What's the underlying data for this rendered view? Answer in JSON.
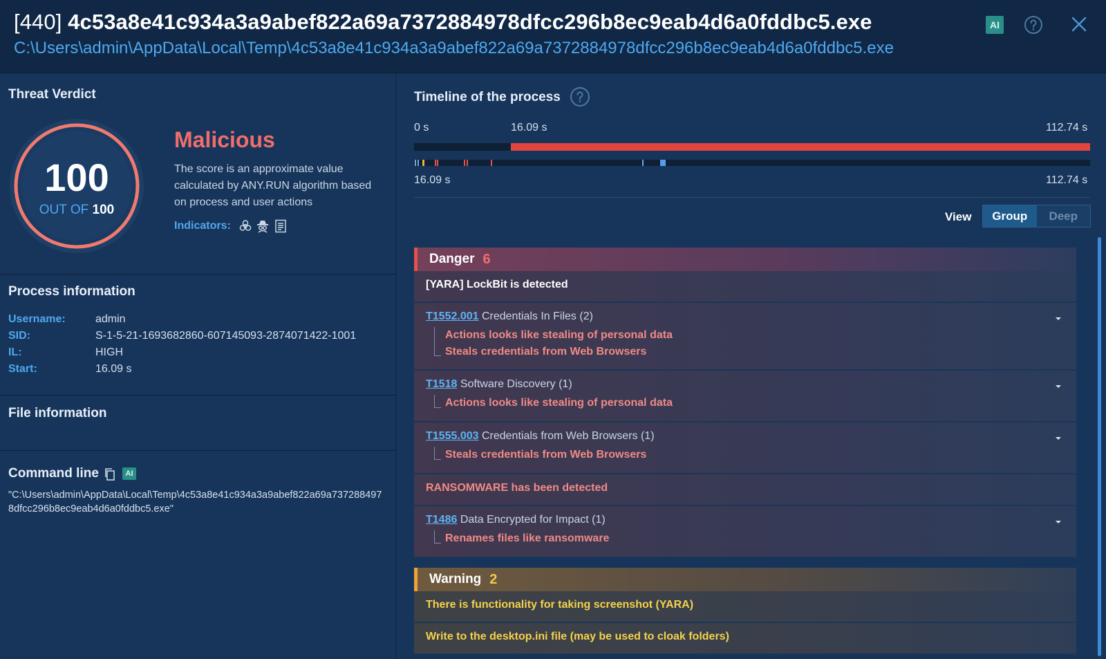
{
  "header": {
    "pid": "[440]",
    "name": "4c53a8e41c934a3a9abef822a69a7372884978dfcc296b8ec9eab4d6a0fddbc5.exe",
    "path": "C:\\Users\\admin\\AppData\\Local\\Temp\\4c53a8e41c934a3a9abef822a69a7372884978dfcc296b8ec9eab4d6a0fddbc5.exe",
    "ai_badge": "AI",
    "icons": [
      "help-icon",
      "close-icon"
    ]
  },
  "threat_verdict": {
    "title": "Threat Verdict",
    "score": "100",
    "out_of_label": "OUT OF",
    "out_of_value": "100",
    "verdict": "Malicious",
    "description": "The score is an approximate value calculated by ANY.RUN algorithm based on process and user actions",
    "indicators_label": "Indicators:",
    "indicator_icons": [
      "biohazard-icon",
      "spy-icon",
      "document-icon"
    ],
    "colors": {
      "verdict": "#f06e6a",
      "ring": "#f07a6f"
    }
  },
  "process_info": {
    "title": "Process information",
    "fields": [
      {
        "key": "Username:",
        "value": "admin"
      },
      {
        "key": "SID:",
        "value": "S-1-5-21-1693682860-607145093-2874071422-1001"
      },
      {
        "key": "IL:",
        "value": "HIGH"
      },
      {
        "key": "Start:",
        "value": "16.09 s"
      }
    ]
  },
  "file_info": {
    "title": "File information"
  },
  "command_line": {
    "title": "Command line",
    "ai_badge": "AI",
    "text": "\"C:\\Users\\admin\\AppData\\Local\\Temp\\4c53a8e41c934a3a9abef822a69a7372884978dfcc296b8ec9eab4d6a0fddbc5.exe\""
  },
  "timeline": {
    "title": "Timeline of the process",
    "start_label": "0 s",
    "process_start_label": "16.09 s",
    "end_label": "112.74 s",
    "zoom_start_label": "16.09 s",
    "zoom_end_label": "112.74 s",
    "process_start": 16.09,
    "total": 112.74
  },
  "view": {
    "label": "View",
    "options": [
      "Group",
      "Deep"
    ],
    "selected": "Group"
  },
  "groups": {
    "danger": {
      "name": "Danger",
      "count": "6",
      "items": {
        "yara": "[YARA] LockBit is detected",
        "t1552_id": "T1552.001",
        "t1552_name": "Credentials In Files (2)",
        "t1552_subs": [
          "Actions looks like stealing of personal data",
          "Steals credentials from Web Browsers"
        ],
        "t1518_id": "T1518",
        "t1518_name": "Software Discovery (1)",
        "t1518_subs": [
          "Actions looks like stealing of personal data"
        ],
        "t1555_id": "T1555.003",
        "t1555_name": "Credentials from Web Browsers (1)",
        "t1555_subs": [
          "Steals credentials from Web Browsers"
        ],
        "ransomware": "RANSOMWARE has been detected",
        "t1486_id": "T1486",
        "t1486_name": "Data Encrypted for Impact (1)",
        "t1486_subs": [
          "Renames files like ransomware"
        ]
      }
    },
    "warning": {
      "name": "Warning",
      "count": "2",
      "items": [
        "There is functionality for taking screenshot (YARA)",
        "Write to the desktop.ini file (may be used to cloak folders)"
      ]
    }
  }
}
